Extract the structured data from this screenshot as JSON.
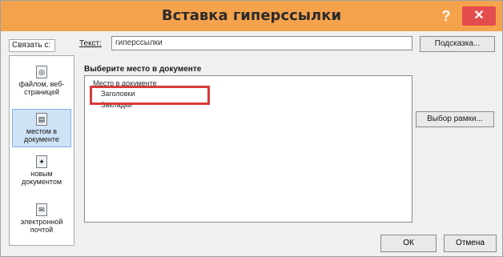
{
  "window": {
    "title": "Вставка гиперссылки",
    "help_icon": "question-mark-icon",
    "help_symbol": "?",
    "close_icon": "close-icon",
    "close_symbol": "✕",
    "accent_color": "#f5a24c",
    "close_color": "#e44d4d"
  },
  "link_to": {
    "label": "Связать с:"
  },
  "text_field": {
    "label": "Текст:",
    "value": "гиперссылки"
  },
  "hint_button": {
    "label": "Подсказка..."
  },
  "sidebar": {
    "items": [
      {
        "label_line1": "файлом, веб-",
        "label_line2": "страницей",
        "icon": "globe-file-icon",
        "selected": false
      },
      {
        "label_line1": "местом в",
        "label_line2": "документе",
        "icon": "document-place-icon",
        "selected": true
      },
      {
        "label_line1": "новым",
        "label_line2": "документом",
        "icon": "new-document-icon",
        "selected": false
      },
      {
        "label_line1": "электронной",
        "label_line2": "почтой",
        "icon": "email-icon",
        "selected": false
      }
    ]
  },
  "main": {
    "choose_label": "Выберите место в документе",
    "tree": [
      "Место в документе",
      "Заголовки",
      "Закладки"
    ]
  },
  "frame_button": {
    "label": "Выбор рамки..."
  },
  "footer": {
    "ok_label": "ОК",
    "cancel_label": "Отмена"
  }
}
